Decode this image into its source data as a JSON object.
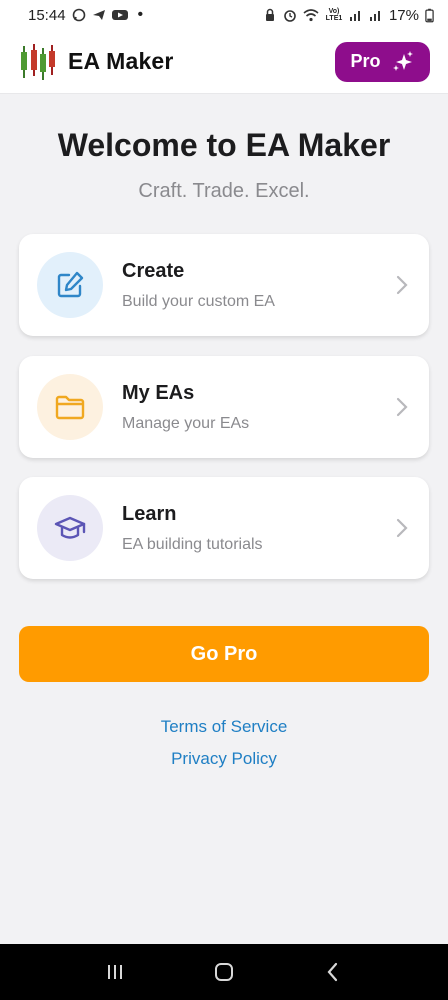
{
  "status_bar": {
    "time": "15:44",
    "battery": "17%",
    "net_label": "Vo) LTE1"
  },
  "app_bar": {
    "title": "EA Maker",
    "pro_label": "Pro"
  },
  "hero": {
    "title": "Welcome to EA Maker",
    "subtitle": "Craft. Trade. Excel."
  },
  "cards": [
    {
      "title": "Create",
      "description": "Build your custom EA",
      "icon": "edit-icon"
    },
    {
      "title": "My EAs",
      "description": "Manage your EAs",
      "icon": "folder-icon"
    },
    {
      "title": "Learn",
      "description": "EA building tutorials",
      "icon": "graduation-cap-icon"
    }
  ],
  "go_pro_label": "Go Pro",
  "links": {
    "terms": "Terms of Service",
    "privacy": "Privacy Policy"
  },
  "colors": {
    "pro_button": "#8e0d8c",
    "go_pro": "#ff9b00",
    "link": "#1f7fc4",
    "create_icon": "#2f86c8",
    "my_eas_icon": "#f0a820",
    "learn_icon": "#5b55b5"
  }
}
